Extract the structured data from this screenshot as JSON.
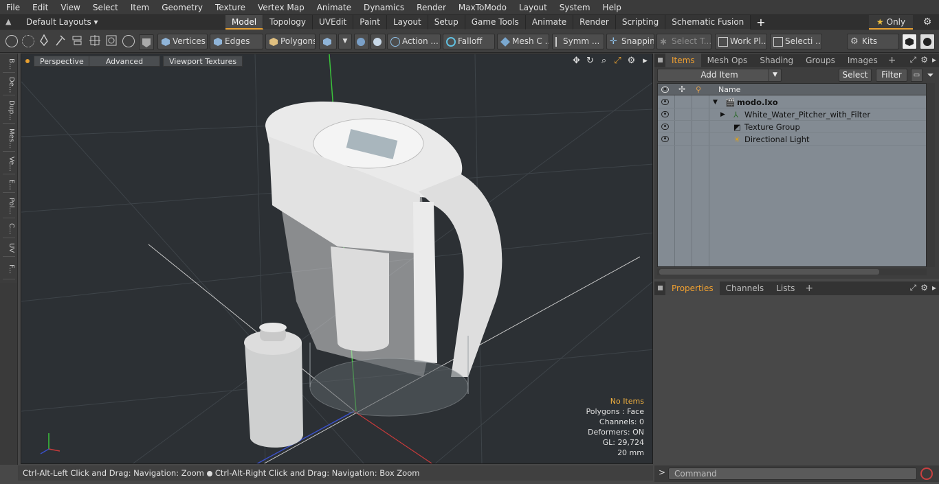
{
  "menu": [
    "File",
    "Edit",
    "View",
    "Select",
    "Item",
    "Geometry",
    "Texture",
    "Vertex Map",
    "Animate",
    "Dynamics",
    "Render",
    "MaxToModo",
    "Layout",
    "System",
    "Help"
  ],
  "layoutbar": {
    "layouts_label": "Default Layouts ▾",
    "tabs": [
      "Model",
      "Topology",
      "UVEdit",
      "Paint",
      "Layout",
      "Setup",
      "Game Tools",
      "Animate",
      "Render",
      "Scripting",
      "Schematic Fusion"
    ],
    "active_tab": "Model",
    "only_label": "Only"
  },
  "toolbar": {
    "vertices": "Vertices",
    "edges": "Edges",
    "polygons": "Polygons",
    "action": "Action ...",
    "falloff": "Falloff",
    "mesh": "Mesh C ...",
    "symmetry": "Symm ...",
    "snapping": "Snapping",
    "select_t": "Select T...",
    "workplane": "Work Pl...",
    "selection": "Selecti ...",
    "kits": "Kits"
  },
  "left_strip": [
    "B...",
    "De...",
    "Dup...",
    "Mes...",
    "Ve...",
    "E...",
    "Pol...",
    "C...",
    "UV",
    "F..."
  ],
  "viewport": {
    "perspective": "Perspective",
    "advanced": "Advanced",
    "viewport_textures": "Viewport Textures",
    "hud": {
      "no_items": "No Items",
      "polygons": "Polygons : Face",
      "channels": "Channels: 0",
      "deformers": "Deformers: ON",
      "gl": "GL: 29,724",
      "scale": "20 mm"
    }
  },
  "status": {
    "left": "Ctrl-Alt-Left Click and Drag: Navigation: Zoom",
    "right": "Ctrl-Alt-Right Click and Drag: Navigation: Box Zoom"
  },
  "items_panel": {
    "tabs": [
      "Items",
      "Mesh Ops",
      "Shading",
      "Groups",
      "Images"
    ],
    "active_tab": "Items",
    "add_item": "Add Item",
    "select": "Select",
    "filter": "Filter",
    "name_header": "Name",
    "tree": [
      {
        "label": "modo.lxo",
        "bold": true
      },
      {
        "label": "White_Water_Pitcher_with_Filter",
        "bold": false
      },
      {
        "label": "Texture Group",
        "bold": false
      },
      {
        "label": "Directional Light",
        "bold": false
      }
    ]
  },
  "props_panel": {
    "tabs": [
      "Properties",
      "Channels",
      "Lists"
    ],
    "active_tab": "Properties"
  },
  "command": {
    "placeholder": "Command"
  },
  "colors": {
    "accent": "#e8a030",
    "viewport_bg": "#2c3034",
    "tree_bg": "#838b93"
  }
}
